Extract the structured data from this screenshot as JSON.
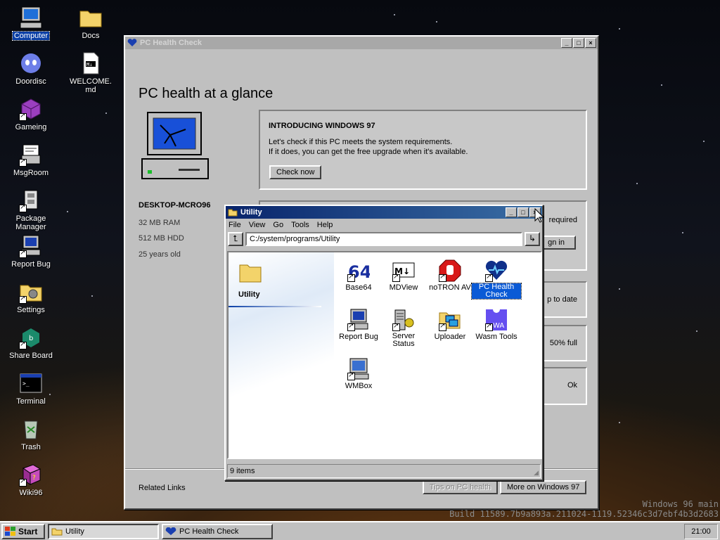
{
  "desktop_icons": [
    {
      "label": "Computer",
      "icon": "computer-icon",
      "selected": true
    },
    {
      "label": "Docs",
      "icon": "folder-icon"
    },
    {
      "label": "Doordisc",
      "icon": "doordisc-icon"
    },
    {
      "label": "WELCOME.md",
      "icon": "markdown-file-icon"
    },
    {
      "label": "Gameing",
      "icon": "game-cube-icon"
    },
    {
      "label": "MsgRoom",
      "icon": "msgroom-icon"
    },
    {
      "label": "Package Manager",
      "icon": "package-icon"
    },
    {
      "label": "Report Bug",
      "icon": "report-bug-icon"
    },
    {
      "label": "Settings",
      "icon": "settings-icon"
    },
    {
      "label": "Share Board",
      "icon": "share-board-icon"
    },
    {
      "label": "Terminal",
      "icon": "terminal-icon"
    },
    {
      "label": "Trash",
      "icon": "trash-icon"
    },
    {
      "label": "Wiki96",
      "icon": "wiki-book-icon"
    }
  ],
  "health_window": {
    "title": "PC Health Check",
    "heading": "PC health at a glance",
    "device_name": "DESKTOP-MCRO96",
    "specs": [
      "32 MB RAM",
      "512 MB HDD",
      "25 years old"
    ],
    "intro_title": "INTRODUCING WINDOWS 97",
    "intro_line1": "Let's check if this PC meets the system requirements.",
    "intro_line2": "If it does, you can get the free upgrade when it's available.",
    "check_button": "Check now",
    "partial_required": "required",
    "partial_signin": "gn in",
    "partial_uptodate": "p to date",
    "partial_full": "50% full",
    "partial_ok": "Ok",
    "related_links": "Related Links",
    "tips_button": "Tips on PC health",
    "more_button": "More on Windows 97"
  },
  "utility_window": {
    "title": "Utility",
    "menu": [
      "File",
      "View",
      "Go",
      "Tools",
      "Help"
    ],
    "path": "C:/system/programs/Utility",
    "folder_label": "Utility",
    "status": "9 items",
    "items": [
      {
        "label": "Base64",
        "icon": "base64-icon"
      },
      {
        "label": "MDView",
        "icon": "mdview-icon"
      },
      {
        "label": "noTRON AV",
        "icon": "notron-av-icon"
      },
      {
        "label": "PC Health Check",
        "icon": "pc-health-icon",
        "selected": true
      },
      {
        "label": "Report Bug",
        "icon": "report-bug-icon"
      },
      {
        "label": "Server Status",
        "icon": "server-status-icon"
      },
      {
        "label": "Uploader",
        "icon": "uploader-icon"
      },
      {
        "label": "Wasm Tools",
        "icon": "wasm-tools-icon"
      },
      {
        "label": "WMBox",
        "icon": "wmbox-icon"
      }
    ]
  },
  "taskbar": {
    "start": "Start",
    "tasks": [
      "Utility",
      "PC Health Check"
    ],
    "clock": "21:00"
  },
  "watermark": {
    "line1": "Windows 96 main",
    "line2": "Build 11589.7b9a893a.211024-1119.52346c3d7ebf4b3d2683"
  },
  "colors": {
    "title_active": "#08246b",
    "selection": "#0a3fa6",
    "window_face": "#c0c0c0"
  }
}
